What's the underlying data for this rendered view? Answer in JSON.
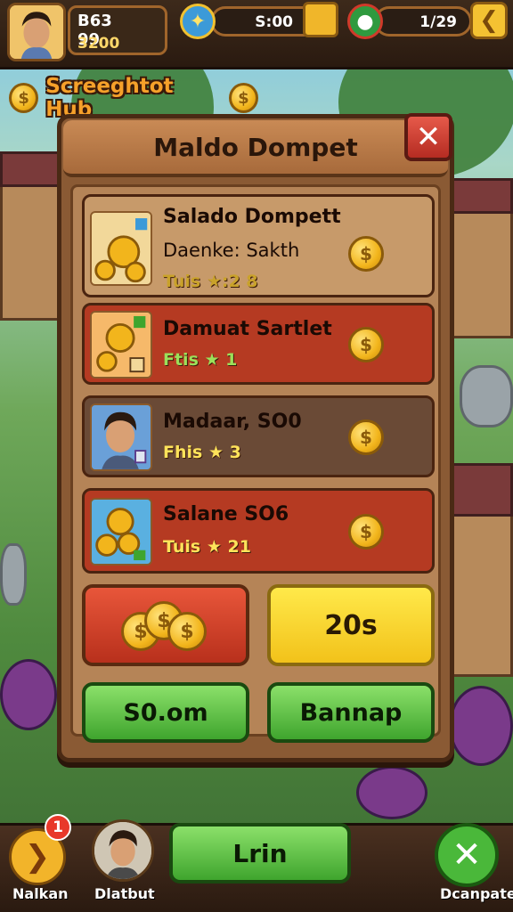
{
  "topbar": {
    "stat_value": "B63 99",
    "stat_sub": "3200",
    "timer": "S:00",
    "counter": "1/29",
    "arrow_glyph": "❮"
  },
  "hub": {
    "title": "Screeghtot Hub",
    "coin_glyph": "$"
  },
  "panel": {
    "title": "Maldo Dompet",
    "close_glyph": "✕",
    "rows": [
      {
        "title": "Salado Dompett",
        "sub": "Daenke: Sakth",
        "stat": "Tuis ★:2 8",
        "coin": "$"
      },
      {
        "title": "Damuat  Sartlet",
        "stat": "Ftis ★ 1",
        "coin": "$"
      },
      {
        "title": "Madaar, SO0",
        "stat": "Fhis ★ 3",
        "coin": "$"
      },
      {
        "title": "Salane  SO6",
        "stat": "Tuis ★ 21",
        "coin": "$"
      }
    ],
    "yellow_value": "20s",
    "btn_left": "S0.om",
    "btn_right": "Bannap"
  },
  "bottombar": {
    "left_label": "Nalkan",
    "left_badge": "1",
    "left_glyph": "❯",
    "mid_label": "Dlatbut",
    "center_button": "Lrin",
    "right_label": "Dcanpate",
    "right_glyph": "✕"
  },
  "colors": {
    "accent_gold": "#f2b51c",
    "panel_brown": "#8a5a34",
    "danger_red": "#b53a22",
    "go_green": "#3fa52e"
  },
  "icons": [
    "gem-icon",
    "globe-icon",
    "chest-icon",
    "coin-icon",
    "close-icon",
    "star-icon"
  ]
}
